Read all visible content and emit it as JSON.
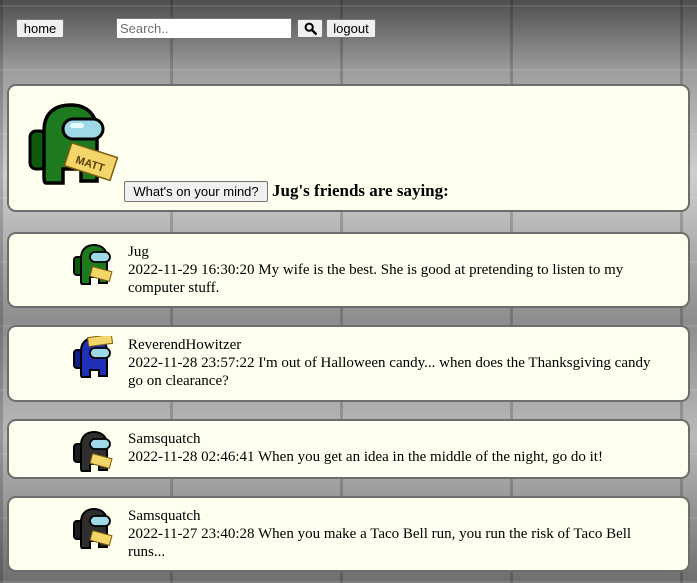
{
  "nav": {
    "home_label": "home",
    "search_placeholder": "Search..",
    "search_value": "",
    "search_button_icon": "search-icon",
    "logout_label": "logout"
  },
  "profile": {
    "avatar_text": "MATT",
    "mind_button_label": "What's on your mind?",
    "friends_heading": "Jug's friends are saying:"
  },
  "posts": [
    {
      "author": "Jug",
      "timestamp": "2022-11-29 16:30:20",
      "text": "My wife is the best. She is good at pretending to listen to my computer stuff.",
      "avatar_color": "#1e7a1e"
    },
    {
      "author": "ReverendHowitzer",
      "timestamp": "2022-11-28 23:57:22",
      "text": "I'm out of Halloween candy... when does the Thanksgiving candy go on clearance?",
      "avatar_color": "#1f2fb8"
    },
    {
      "author": "Samsquatch",
      "timestamp": "2022-11-28 02:46:41",
      "text": "When you get an idea in the middle of the night, go do it!",
      "avatar_color": "#2e2e2e"
    },
    {
      "author": "Samsquatch",
      "timestamp": "2022-11-27 23:40:28",
      "text": "When you make a Taco Bell run, you run the risk of Taco Bell runs...",
      "avatar_color": "#2e2e2e"
    }
  ]
}
